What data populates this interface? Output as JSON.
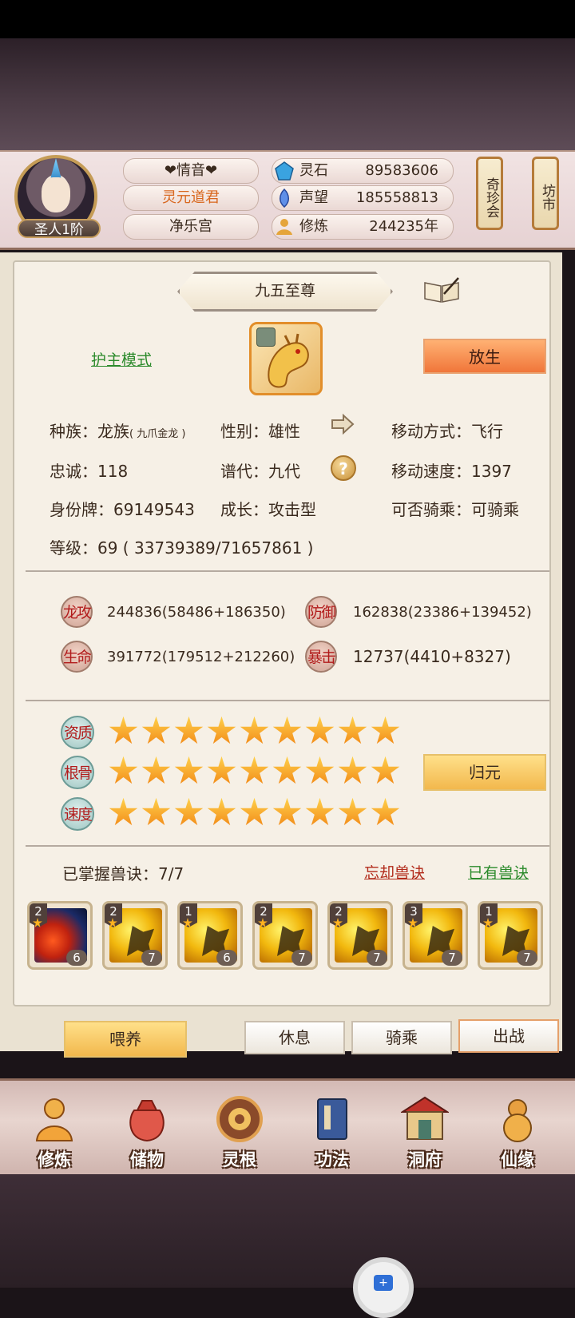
{
  "header": {
    "rank_badge": "圣人1阶",
    "name_pills": [
      "❤情音❤",
      "灵元道君",
      "净乐宫"
    ],
    "stats": [
      {
        "label": "灵石",
        "value": "89583606",
        "icon": "spirit-stone-icon"
      },
      {
        "label": "声望",
        "value": "185558813",
        "icon": "prestige-icon"
      },
      {
        "label": "修炼",
        "value": "244235年",
        "icon": "cultivation-icon"
      }
    ],
    "side_buttons": [
      "奇珍会",
      "坊市"
    ]
  },
  "pet": {
    "title": "九五至尊",
    "guard_mode_link": "护主模式",
    "release_button": "放生",
    "info": {
      "race": "种族：龙族",
      "race_sub": "( 九爪金龙 )",
      "gender": "性别：雄性",
      "move_type": "移动方式：飞行",
      "loyalty": "忠诚：118",
      "generation": "谱代：九代",
      "move_speed": "移动速度：1397",
      "id_tag": "身份牌：69149543",
      "growth": "成长：攻击型",
      "rideable": "可否骑乘：可骑乘",
      "level": "等级：69 ( 33739389/71657861 )"
    },
    "attributes": [
      {
        "label": "龙攻",
        "value": "244836(58486+186350)"
      },
      {
        "label": "防御",
        "value": "162838(23386+139452)"
      },
      {
        "label": "生命",
        "value": "391772(179512+212260)"
      },
      {
        "label": "暴击",
        "value": "12737(4410+8327)"
      }
    ],
    "aptitudes": [
      {
        "label": "资质",
        "stars": 9
      },
      {
        "label": "根骨",
        "stars": 9
      },
      {
        "label": "速度",
        "stars": 9
      }
    ],
    "return_button": "归元",
    "skills_mastered": "已掌握兽诀：7/7",
    "forget_link": "忘却兽诀",
    "owned_link": "已有兽诀",
    "skills": [
      {
        "tier": "2",
        "level": "6"
      },
      {
        "tier": "2",
        "level": "7"
      },
      {
        "tier": "1",
        "level": "6"
      },
      {
        "tier": "2",
        "level": "7"
      },
      {
        "tier": "2",
        "level": "7"
      },
      {
        "tier": "3",
        "level": "7"
      },
      {
        "tier": "1",
        "level": "7"
      }
    ]
  },
  "actions": {
    "feed": "喂养",
    "rest": "休息",
    "ride": "骑乘",
    "battle": "出战"
  },
  "nav": [
    {
      "label": "修炼",
      "icon": "monk-icon"
    },
    {
      "label": "储物",
      "icon": "bag-icon"
    },
    {
      "label": "灵根",
      "icon": "spirit-root-icon"
    },
    {
      "label": "功法",
      "icon": "scripture-icon"
    },
    {
      "label": "洞府",
      "icon": "cave-house-icon"
    },
    {
      "label": "仙缘",
      "icon": "gourd-icon"
    }
  ],
  "colors": {
    "accent_orange": "#f0763a",
    "gold": "#f2b84d",
    "link_green": "#2b8a2b",
    "link_red": "#b22b1b"
  }
}
